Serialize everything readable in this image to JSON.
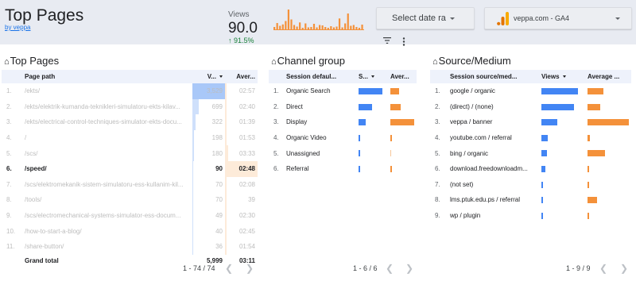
{
  "header": {
    "title": "Top Pages",
    "subtitle": "by veppa",
    "views_label": "Views",
    "views_value": "90.0",
    "views_delta": "91.5%",
    "date_button": "Select date ra",
    "site_button": "veppa.com - GA4"
  },
  "pages_panel": {
    "title": "Top Pages",
    "col_path": "Page path",
    "col_views": "V...",
    "col_avg": "Aver...",
    "rows": [
      {
        "rank": "1.",
        "path": "/ekts/",
        "views": "3,529",
        "avg": "02:57",
        "vfrac": 1.0,
        "afrac": 0.05
      },
      {
        "rank": "2.",
        "path": "/ekts/elektrik-kumanda-teknikleri-simulatoru-ekts-kilav...",
        "views": "699",
        "avg": "02:40",
        "vfrac": 0.2,
        "afrac": 0.05
      },
      {
        "rank": "3.",
        "path": "/ekts/electrical-control-techniques-simulator-ekts-docu...",
        "views": "322",
        "avg": "01:39",
        "vfrac": 0.09,
        "afrac": 0.05
      },
      {
        "rank": "4.",
        "path": "/",
        "views": "198",
        "avg": "01:53",
        "vfrac": 0.06,
        "afrac": 0.05
      },
      {
        "rank": "5.",
        "path": "/scs/",
        "views": "180",
        "avg": "03:33",
        "vfrac": 0.05,
        "afrac": 0.1
      },
      {
        "rank": "6.",
        "path": "/speed/",
        "views": "90",
        "avg": "02:48",
        "vfrac": 0.03,
        "afrac": 1.0
      },
      {
        "rank": "7.",
        "path": "/scs/elektromekanik-sistem-simulatoru-ess-kullanim-kil...",
        "views": "70",
        "avg": "02:08",
        "vfrac": 0.02,
        "afrac": 0.05
      },
      {
        "rank": "8.",
        "path": "/tools/",
        "views": "70",
        "avg": "39",
        "vfrac": 0.02,
        "afrac": 0.05
      },
      {
        "rank": "9.",
        "path": "/scs/electromechanical-systems-simulator-ess-docum...",
        "views": "49",
        "avg": "02:30",
        "vfrac": 0.01,
        "afrac": 0.05
      },
      {
        "rank": "10.",
        "path": "/how-to-start-a-blog/",
        "views": "40",
        "avg": "02:45",
        "vfrac": 0.01,
        "afrac": 0.05
      },
      {
        "rank": "11.",
        "path": "/share-button/",
        "views": "36",
        "avg": "01:54",
        "vfrac": 0.01,
        "afrac": 0.05
      }
    ],
    "total_label": "Grand total",
    "total_views": "5,999",
    "total_avg": "03:11",
    "pager": "1 - 74 / 74"
  },
  "channel_panel": {
    "title": "Channel group",
    "col_group": "Session defaul...",
    "col_s": "S...",
    "col_avg": "Aver...",
    "rows": [
      {
        "rank": "1.",
        "name": "Organic Search",
        "bar1": 1.0,
        "bar2": 0.38
      },
      {
        "rank": "2.",
        "name": "Direct",
        "bar1": 0.58,
        "bar2": 0.42
      },
      {
        "rank": "3.",
        "name": "Display",
        "bar1": 0.3,
        "bar2": 1.0
      },
      {
        "rank": "4.",
        "name": "Organic Video",
        "bar1": 0.07,
        "bar2": 0.08
      },
      {
        "rank": "5.",
        "name": "Unassigned",
        "bar1": 0.07,
        "bar2": 0.0
      },
      {
        "rank": "6.",
        "name": "Referral",
        "bar1": 0.05,
        "bar2": 0.08
      }
    ],
    "pager": "1 - 6 / 6"
  },
  "source_panel": {
    "title": "Source/Medium",
    "col_source": "Session source/med...",
    "col_views": "Views",
    "col_avg": "Average ...",
    "rows": [
      {
        "rank": "1.",
        "name": "google / organic",
        "bar1": 1.0,
        "bar2": 0.38
      },
      {
        "rank": "2.",
        "name": "(direct) / (none)",
        "bar1": 0.9,
        "bar2": 0.3
      },
      {
        "rank": "3.",
        "name": "veppa / banner",
        "bar1": 0.43,
        "bar2": 1.0
      },
      {
        "rank": "4.",
        "name": "youtube.com / referral",
        "bar1": 0.17,
        "bar2": 0.05
      },
      {
        "rank": "5.",
        "name": "bing / organic",
        "bar1": 0.15,
        "bar2": 0.42
      },
      {
        "rank": "6.",
        "name": "download.freedownloadm...",
        "bar1": 0.11,
        "bar2": 0.04
      },
      {
        "rank": "7.",
        "name": "(not set)",
        "bar1": 0.05,
        "bar2": 0.03
      },
      {
        "rank": "8.",
        "name": "lms.ptuk.edu.ps / referral",
        "bar1": 0.05,
        "bar2": 0.24
      },
      {
        "rank": "9.",
        "name": "wp / plugin",
        "bar1": 0.03,
        "bar2": 0.04
      }
    ],
    "pager": "1 - 9 / 9"
  },
  "sparkline": [
    0.12,
    0.32,
    0.18,
    0.25,
    0.42,
    1.0,
    0.5,
    0.22,
    0.14,
    0.35,
    0.08,
    0.3,
    0.1,
    0.12,
    0.28,
    0.1,
    0.22,
    0.2,
    0.12,
    0.08,
    0.16,
    0.1,
    0.14,
    0.55,
    0.1,
    0.3,
    0.8,
    0.18,
    0.22,
    0.12,
    0.08,
    0.24
  ],
  "colors": {
    "accent_blue": "#4285f4",
    "accent_orange": "#f4913a",
    "delta_green": "#188038"
  },
  "icons": {
    "home": "home-icon",
    "filter": "filter-icon",
    "more": "more-vert-icon",
    "ga": "google-analytics-icon"
  }
}
